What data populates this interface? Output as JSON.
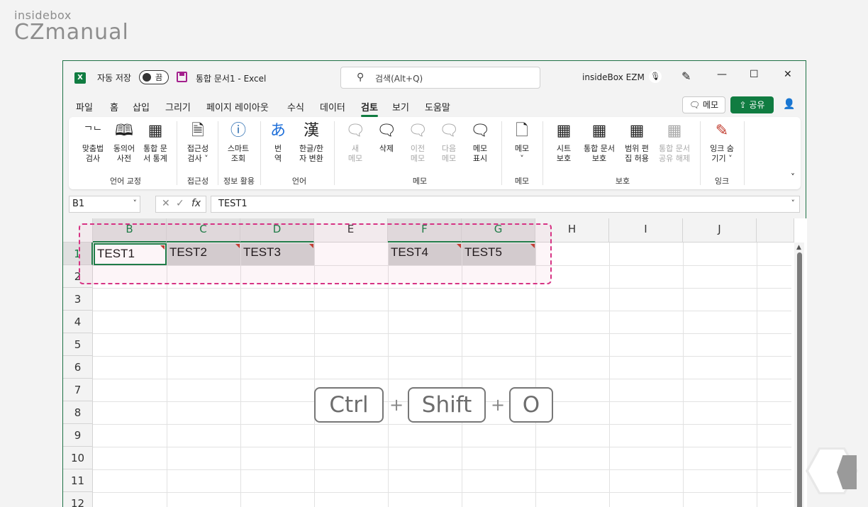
{
  "watermark": {
    "line1": "insidebox",
    "line2": "CZmanual"
  },
  "titlebar": {
    "autosave_label": "자동 저장",
    "toggle_state": "끔",
    "doc_title": "통합 문서1  -  Excel",
    "search_placeholder": "검색(Alt+Q)",
    "user": "insideBox EZM",
    "minimize": "—",
    "maximize": "☐",
    "close": "✕"
  },
  "menu": {
    "items": [
      "파일",
      "홈",
      "삽입",
      "그리기",
      "페이지 레이아웃",
      "수식",
      "데이터",
      "검토",
      "보기",
      "도움말"
    ],
    "active": "검토",
    "memo_button": "메모",
    "share_button": "공유"
  },
  "ribbon": {
    "buttons": [
      {
        "label1": "맞춤법",
        "label2": "검사",
        "icon": "spellcheck-icon",
        "glyph": "ᄀᄂ✓"
      },
      {
        "label1": "동의어",
        "label2": "사전",
        "icon": "thesaurus-icon",
        "glyph": "📖"
      },
      {
        "label1": "통합 문",
        "label2": "서 통계",
        "icon": "workbook-stats-icon",
        "glyph": "▦"
      },
      {
        "label1": "접근성",
        "label2": "검사 ˅",
        "icon": "accessibility-icon",
        "glyph": "🗎"
      },
      {
        "label1": "스마트",
        "label2": "조회",
        "icon": "smart-lookup-icon",
        "glyph": "ⓘ"
      },
      {
        "label1": "번",
        "label2": "역",
        "icon": "translate-icon",
        "glyph": "あ"
      },
      {
        "label1": "한글/한",
        "label2": "자 변환",
        "icon": "hanja-icon",
        "glyph": "漢"
      },
      {
        "label1": "새",
        "label2": "메모",
        "icon": "new-comment-icon",
        "glyph": "🗨",
        "disabled": true
      },
      {
        "label1": "삭제",
        "label2": "",
        "icon": "delete-comment-icon",
        "glyph": "🗨"
      },
      {
        "label1": "이전",
        "label2": "메모",
        "icon": "prev-comment-icon",
        "glyph": "🗨",
        "disabled": true
      },
      {
        "label1": "다음",
        "label2": "메모",
        "icon": "next-comment-icon",
        "glyph": "🗨",
        "disabled": true
      },
      {
        "label1": "메모",
        "label2": "표시",
        "icon": "show-comments-icon",
        "glyph": "🗨"
      },
      {
        "label1": "메모",
        "label2": "˅",
        "icon": "notes-icon",
        "glyph": "🗋"
      },
      {
        "label1": "시트",
        "label2": "보호",
        "icon": "protect-sheet-icon",
        "glyph": "▦"
      },
      {
        "label1": "통합 문서",
        "label2": "보호",
        "icon": "protect-workbook-icon",
        "glyph": "▦"
      },
      {
        "label1": "범위 편",
        "label2": "집 허용",
        "icon": "allow-edit-ranges-icon",
        "glyph": "▦"
      },
      {
        "label1": "통합 문서",
        "label2": "공유 해제",
        "icon": "unshare-workbook-icon",
        "glyph": "▦",
        "disabled": true
      },
      {
        "label1": "잉크 숨",
        "label2": "기기 ˅",
        "icon": "hide-ink-icon",
        "glyph": "✎"
      }
    ],
    "groups": [
      "언어 교정",
      "접근성",
      "정보 활용",
      "언어",
      "메모",
      "메모",
      "보호",
      "잉크"
    ]
  },
  "formula_bar": {
    "name_box": "B1",
    "fx": "fx",
    "value": "TEST1"
  },
  "sheet": {
    "columns": [
      "B",
      "C",
      "D",
      "E",
      "F",
      "G",
      "H",
      "I",
      "J"
    ],
    "selected_columns": [
      "B",
      "C",
      "D",
      "F",
      "G"
    ],
    "rows": [
      "1",
      "2",
      "3",
      "4",
      "5",
      "6",
      "7",
      "8",
      "9",
      "10",
      "11",
      "12"
    ],
    "cells": [
      {
        "col": "B",
        "text": "TEST1",
        "active": true
      },
      {
        "col": "C",
        "text": "TEST2"
      },
      {
        "col": "D",
        "text": "TEST3"
      },
      {
        "col": "F",
        "text": "TEST4"
      },
      {
        "col": "G",
        "text": "TEST5"
      }
    ]
  },
  "shortcut": {
    "key1": "Ctrl",
    "key2": "Shift",
    "key3": "O",
    "plus": "+"
  },
  "colors": {
    "accent": "#107c41",
    "highlight": "#d63384"
  }
}
